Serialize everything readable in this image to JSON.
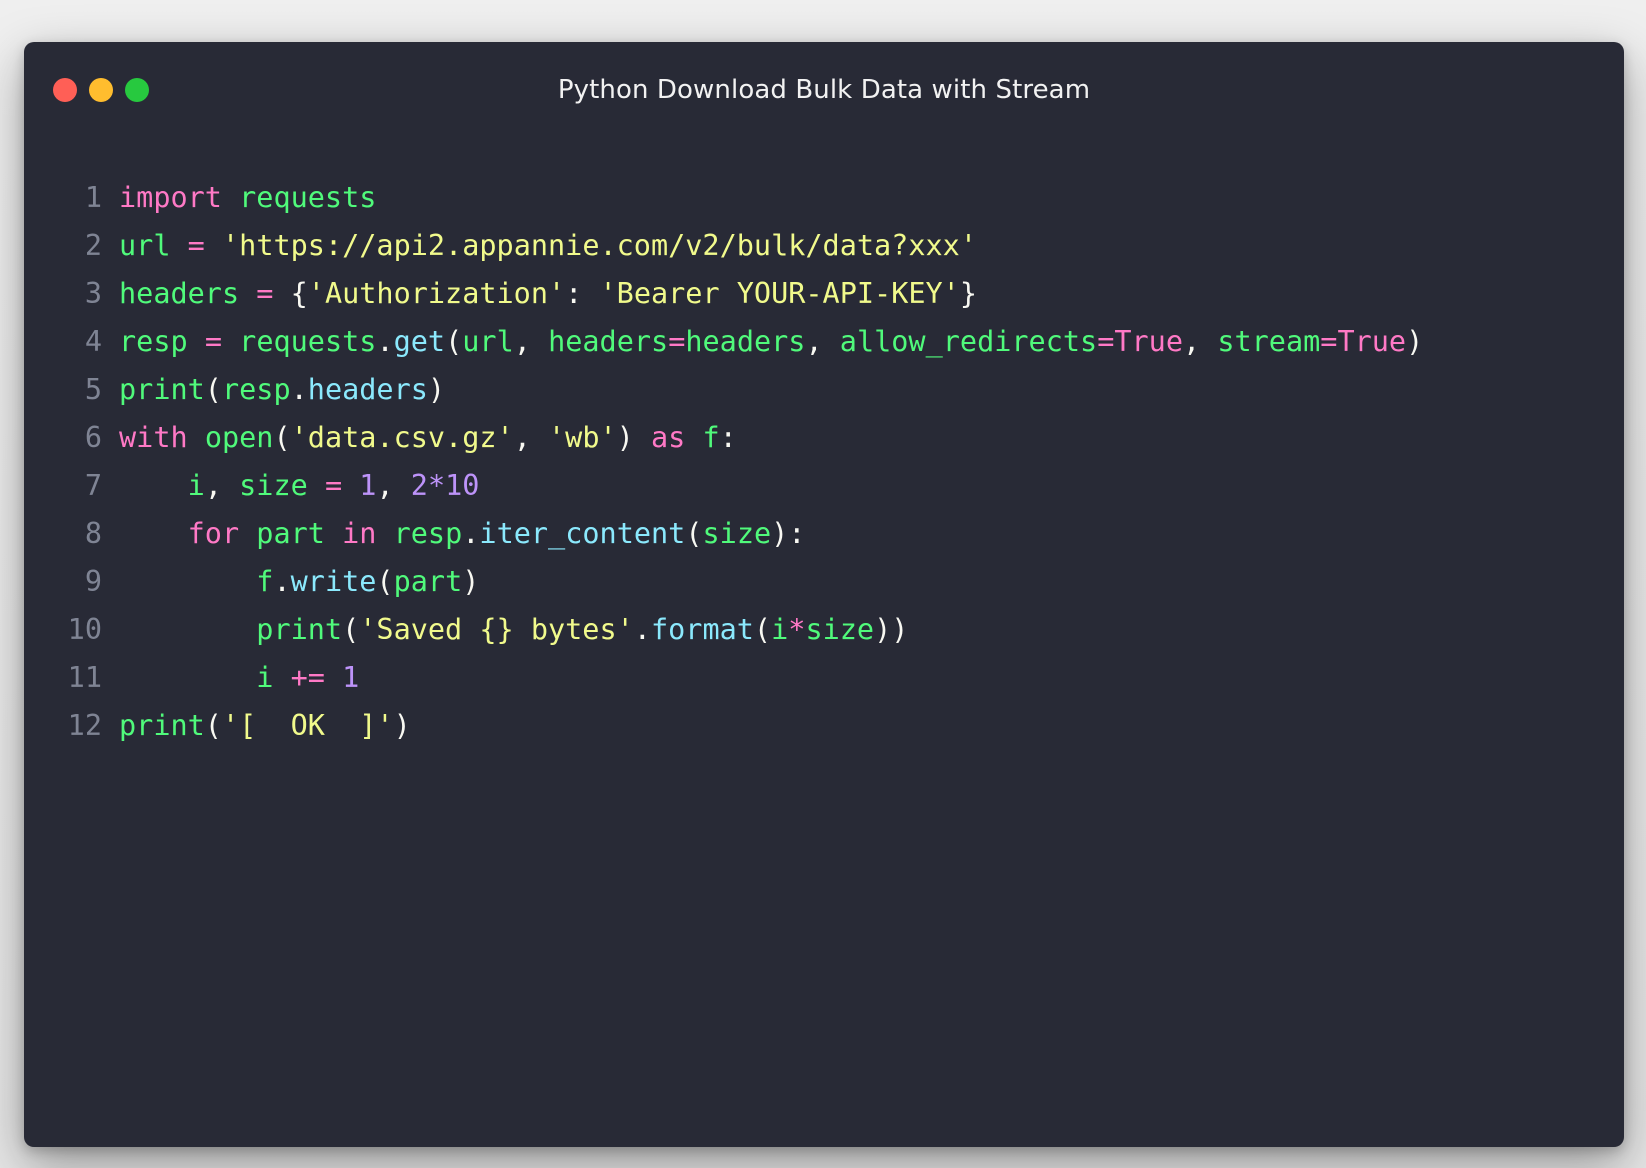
{
  "window": {
    "title": "Python Download Bulk Data with Stream",
    "controls": {
      "close_color": "#ff5f56",
      "minimize_color": "#ffbd2e",
      "maximize_color": "#27c93f"
    }
  },
  "theme": {
    "background": "#282a36",
    "keyword": "#ff79c6",
    "identifier": "#50fa7b",
    "string": "#f1fa8c",
    "number": "#bd93f9",
    "method": "#8be9fd"
  },
  "code": {
    "lines": [
      {
        "n": "1",
        "tokens": [
          [
            "kw",
            "import"
          ],
          [
            "pn",
            " "
          ],
          [
            "id",
            "requests"
          ]
        ]
      },
      {
        "n": "2",
        "tokens": [
          [
            "id",
            "url"
          ],
          [
            "pn",
            " "
          ],
          [
            "op",
            "="
          ],
          [
            "pn",
            " "
          ],
          [
            "str",
            "'https://api2.appannie.com/v2/bulk/data?xxx'"
          ]
        ]
      },
      {
        "n": "3",
        "tokens": [
          [
            "id",
            "headers"
          ],
          [
            "pn",
            " "
          ],
          [
            "op",
            "="
          ],
          [
            "pn",
            " {"
          ],
          [
            "str",
            "'Authorization'"
          ],
          [
            "pn",
            ": "
          ],
          [
            "str",
            "'Bearer YOUR-API-KEY'"
          ],
          [
            "pn",
            "}"
          ]
        ]
      },
      {
        "n": "4",
        "tokens": [
          [
            "id",
            "resp"
          ],
          [
            "pn",
            " "
          ],
          [
            "op",
            "="
          ],
          [
            "pn",
            " "
          ],
          [
            "id",
            "requests"
          ],
          [
            "pn",
            "."
          ],
          [
            "meth",
            "get"
          ],
          [
            "pn",
            "("
          ],
          [
            "id",
            "url"
          ],
          [
            "pn",
            ", "
          ],
          [
            "id",
            "headers"
          ],
          [
            "op",
            "="
          ],
          [
            "id",
            "headers"
          ],
          [
            "pn",
            ", "
          ],
          [
            "id",
            "allow_redirects"
          ],
          [
            "op",
            "="
          ],
          [
            "kw",
            "True"
          ],
          [
            "pn",
            ", "
          ],
          [
            "id",
            "stream"
          ],
          [
            "op",
            "="
          ],
          [
            "kw",
            "True"
          ],
          [
            "pn",
            ")"
          ]
        ]
      },
      {
        "n": "5",
        "tokens": [
          [
            "id",
            "print"
          ],
          [
            "pn",
            "("
          ],
          [
            "id",
            "resp"
          ],
          [
            "pn",
            "."
          ],
          [
            "meth",
            "headers"
          ],
          [
            "pn",
            ")"
          ]
        ]
      },
      {
        "n": "6",
        "tokens": [
          [
            "kw",
            "with"
          ],
          [
            "pn",
            " "
          ],
          [
            "id",
            "open"
          ],
          [
            "pn",
            "("
          ],
          [
            "str",
            "'data.csv.gz'"
          ],
          [
            "pn",
            ", "
          ],
          [
            "str",
            "'wb'"
          ],
          [
            "pn",
            ") "
          ],
          [
            "kw",
            "as"
          ],
          [
            "pn",
            " "
          ],
          [
            "id",
            "f"
          ],
          [
            "pn",
            ":"
          ]
        ]
      },
      {
        "n": "7",
        "tokens": [
          [
            "pn",
            "    "
          ],
          [
            "id",
            "i"
          ],
          [
            "pn",
            ", "
          ],
          [
            "id",
            "size"
          ],
          [
            "pn",
            " "
          ],
          [
            "op",
            "="
          ],
          [
            "pn",
            " "
          ],
          [
            "num",
            "1"
          ],
          [
            "pn",
            ", "
          ],
          [
            "num",
            "2*10"
          ]
        ]
      },
      {
        "n": "8",
        "tokens": [
          [
            "pn",
            "    "
          ],
          [
            "kw",
            "for"
          ],
          [
            "pn",
            " "
          ],
          [
            "id",
            "part"
          ],
          [
            "pn",
            " "
          ],
          [
            "kw",
            "in"
          ],
          [
            "pn",
            " "
          ],
          [
            "id",
            "resp"
          ],
          [
            "pn",
            "."
          ],
          [
            "meth",
            "iter_content"
          ],
          [
            "pn",
            "("
          ],
          [
            "id",
            "size"
          ],
          [
            "pn",
            "):"
          ]
        ]
      },
      {
        "n": "9",
        "tokens": [
          [
            "pn",
            "        "
          ],
          [
            "id",
            "f"
          ],
          [
            "pn",
            "."
          ],
          [
            "meth",
            "write"
          ],
          [
            "pn",
            "("
          ],
          [
            "id",
            "part"
          ],
          [
            "pn",
            ")"
          ]
        ]
      },
      {
        "n": "10",
        "tokens": [
          [
            "pn",
            "        "
          ],
          [
            "id",
            "print"
          ],
          [
            "pn",
            "("
          ],
          [
            "str",
            "'Saved {} bytes'"
          ],
          [
            "pn",
            "."
          ],
          [
            "meth",
            "format"
          ],
          [
            "pn",
            "("
          ],
          [
            "id",
            "i"
          ],
          [
            "op",
            "*"
          ],
          [
            "id",
            "size"
          ],
          [
            "pn",
            "))"
          ]
        ]
      },
      {
        "n": "11",
        "tokens": [
          [
            "pn",
            "        "
          ],
          [
            "id",
            "i"
          ],
          [
            "pn",
            " "
          ],
          [
            "op",
            "+="
          ],
          [
            "pn",
            " "
          ],
          [
            "num",
            "1"
          ]
        ]
      },
      {
        "n": "12",
        "tokens": [
          [
            "id",
            "print"
          ],
          [
            "pn",
            "("
          ],
          [
            "str",
            "'[  OK  ]'"
          ],
          [
            "pn",
            ")"
          ]
        ]
      }
    ]
  }
}
